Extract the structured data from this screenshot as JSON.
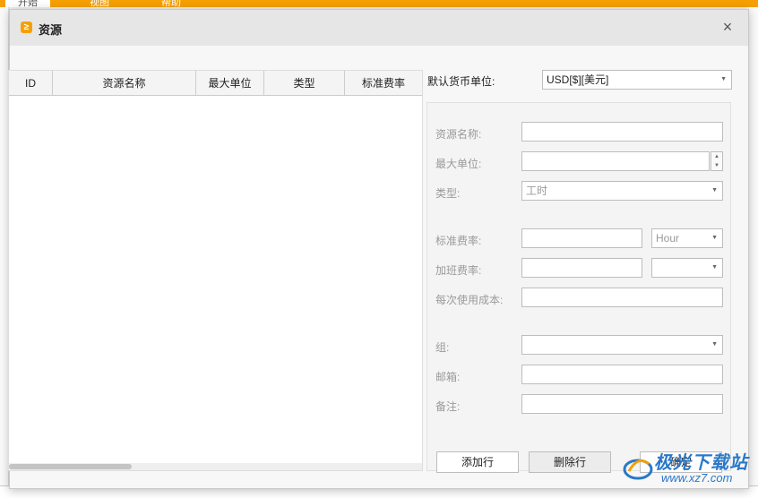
{
  "background": {
    "tabs": [
      {
        "label": "开始"
      },
      {
        "label": "视图"
      },
      {
        "label": "帮助"
      }
    ]
  },
  "dialog": {
    "title": "资源",
    "close_glyph": "×"
  },
  "table": {
    "columns": [
      "ID",
      "资源名称",
      "最大单位",
      "类型",
      "标准费率"
    ],
    "rows": []
  },
  "form": {
    "currency_label": "默认货币单位:",
    "currency_value": "USD[$][美元]",
    "resource_name_label": "资源名称:",
    "max_unit_label": "最大单位:",
    "type_label": "类型:",
    "type_value": "工时",
    "std_rate_label": "标准费率:",
    "std_rate_unit": "Hour",
    "overtime_rate_label": "加班费率:",
    "cost_per_use_label": "每次使用成本:",
    "group_label": "组:",
    "email_label": "邮箱:",
    "notes_label": "备注:"
  },
  "buttons": {
    "add_row": "添加行",
    "delete_row": "删除行",
    "ok": "确定"
  },
  "watermark": {
    "line1": "极光下载站",
    "line2": "www.xz7.com"
  },
  "colors": {
    "ribbon": "#f5a000",
    "watermark": "#2a78c8"
  }
}
